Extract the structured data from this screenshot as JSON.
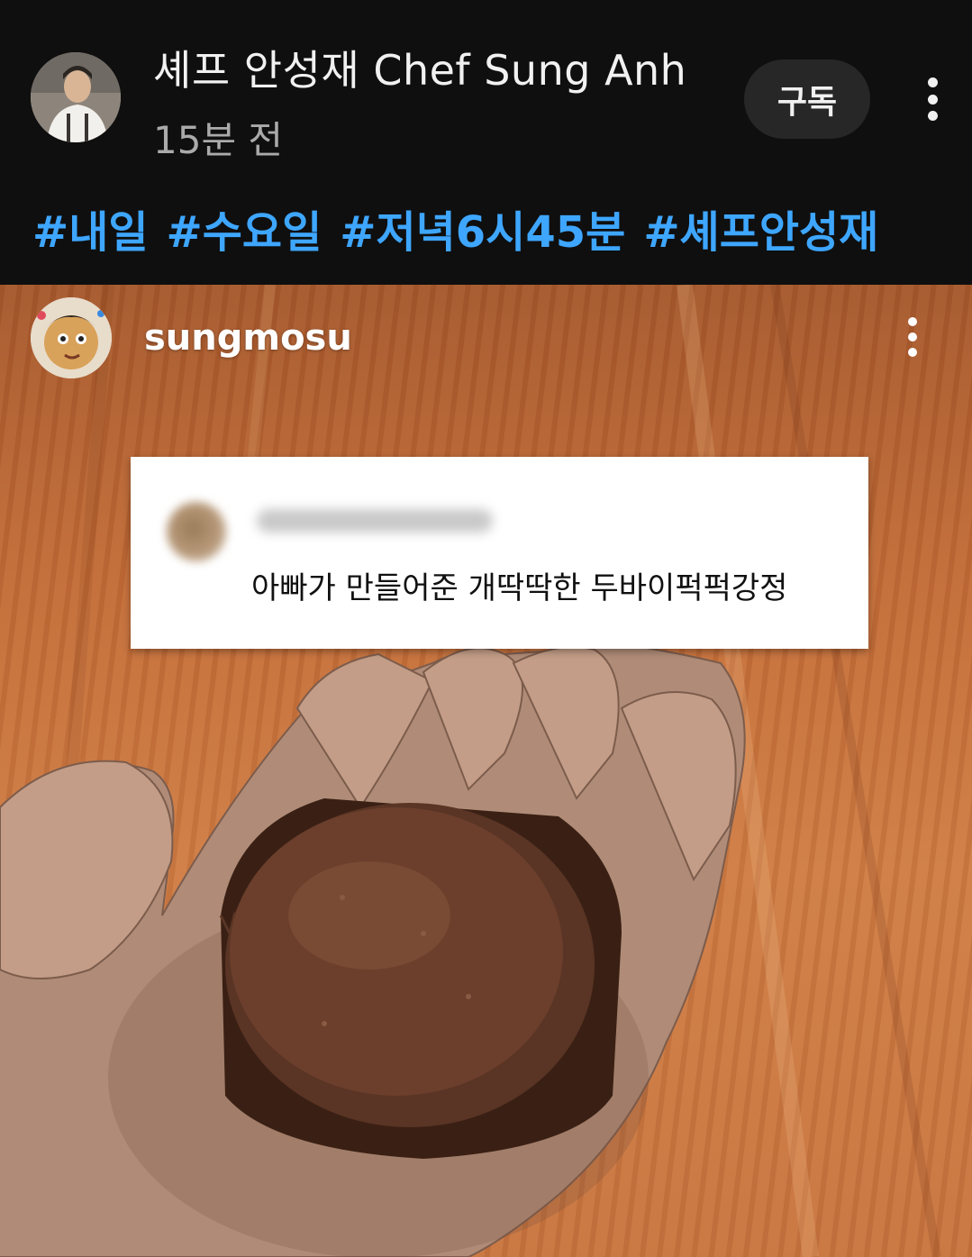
{
  "header": {
    "channel_name": "셰프 안성재 Chef Sung Anh",
    "post_time": "15분 전",
    "subscribe_label": "구독",
    "more_icon": "more-vert-icon",
    "hashtags": [
      "#내일",
      "#수요일",
      "#저녁6시45분",
      "#셰프안성재"
    ]
  },
  "post": {
    "username": "sungmosu",
    "more_icon": "more-vert-icon",
    "comment": {
      "text": "아빠가 만들어준 개딱딱한 두바이퍽퍽강정"
    }
  },
  "colors": {
    "background": "#0f0f0f",
    "hashtag": "#3ea6ff",
    "subscribe_bg": "#272727",
    "time_text": "#aaaaaa"
  }
}
